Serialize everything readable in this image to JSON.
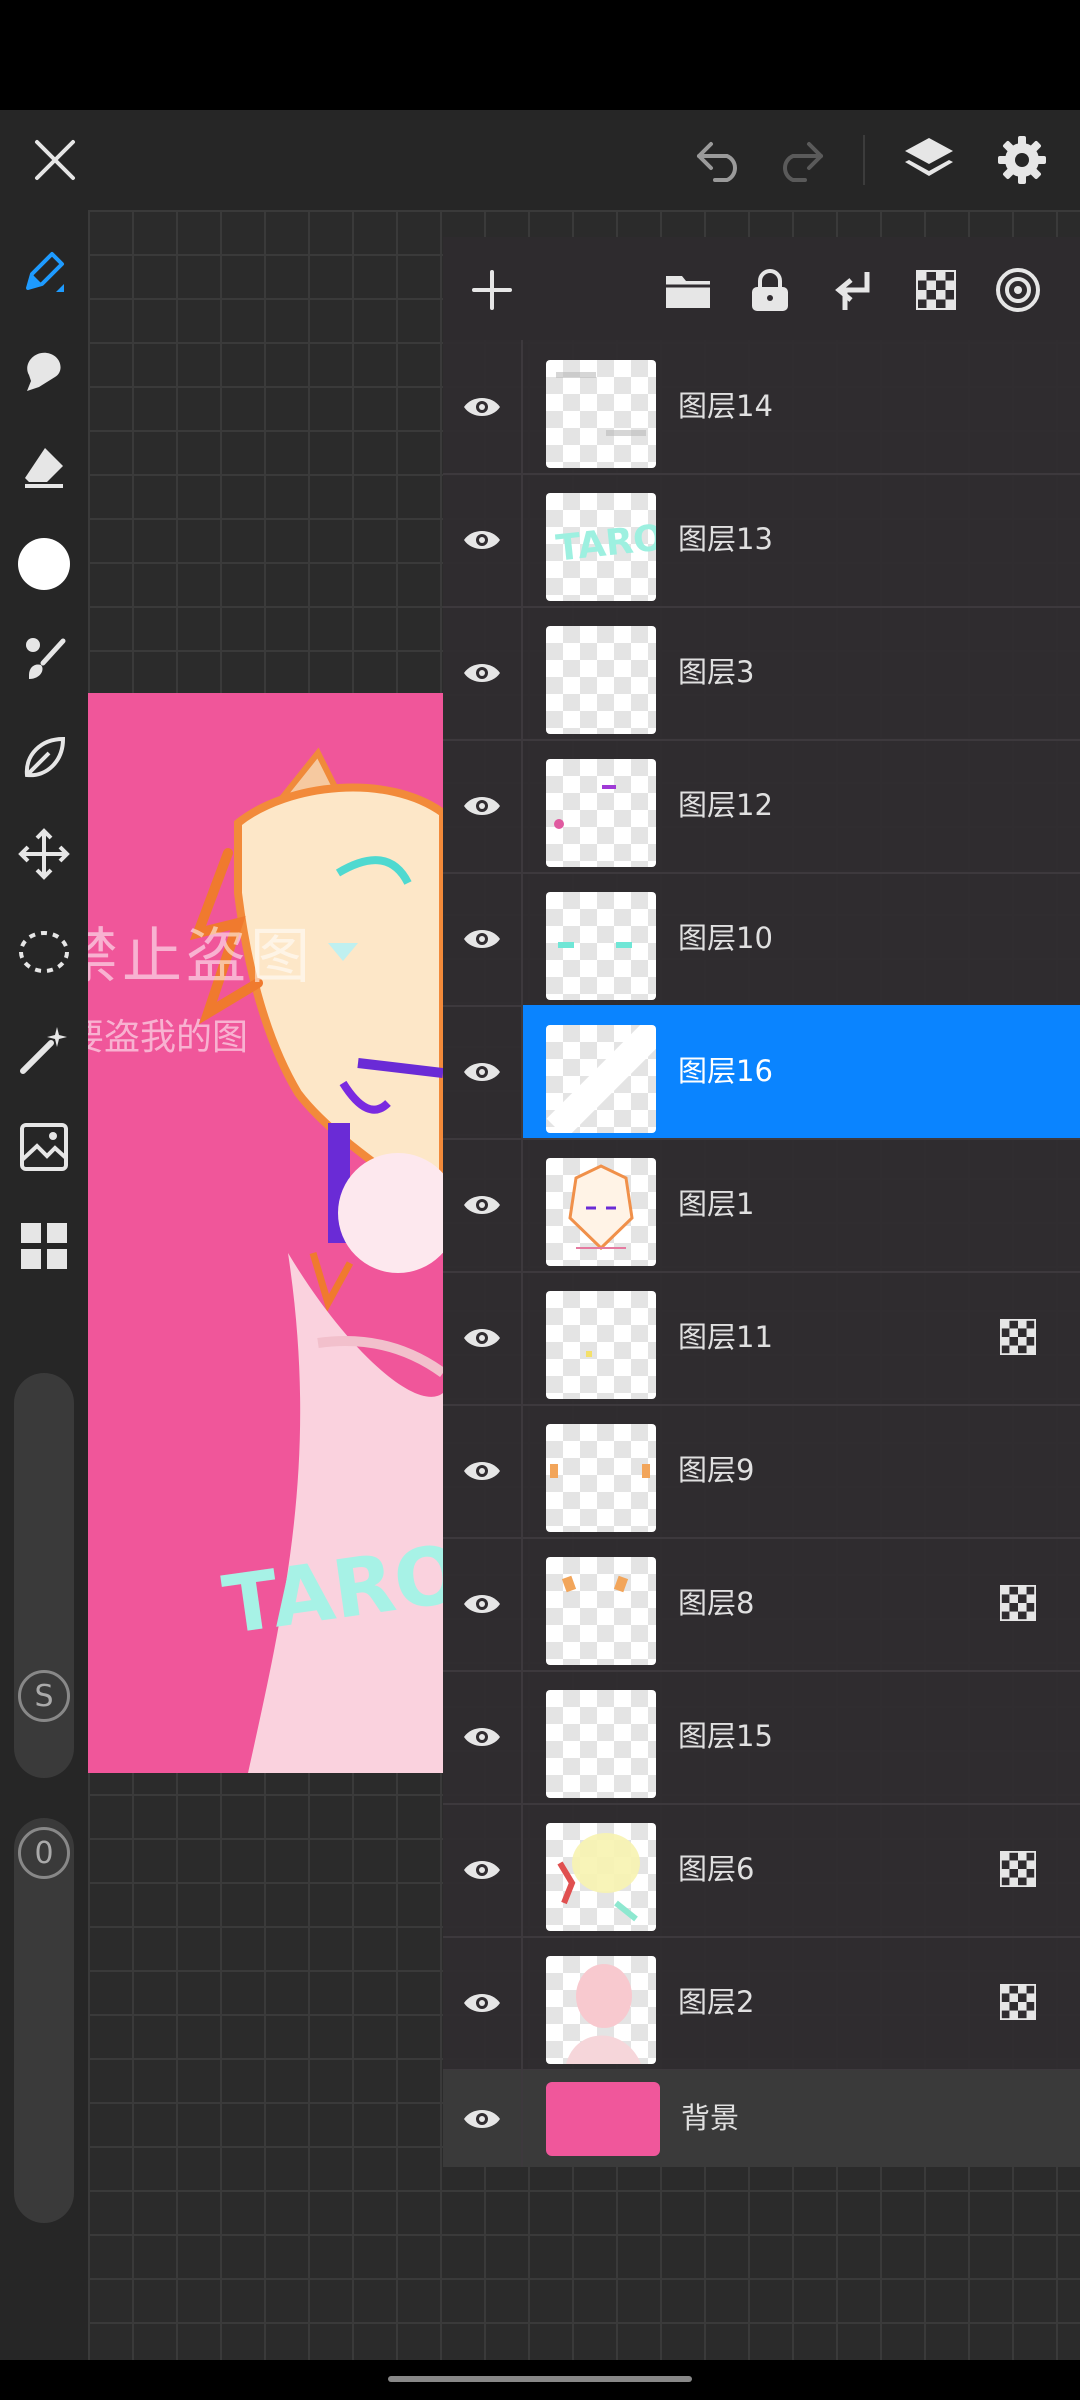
{
  "colors": {
    "accent": "#0a84ff",
    "canvas_bg": "#f0569a",
    "background_swatch": "#f0579b"
  },
  "topbar": {
    "icons": [
      "close-icon",
      "undo-icon",
      "redo-icon",
      "layers-icon",
      "settings-icon"
    ]
  },
  "toolbar": {
    "tools": [
      "pen-icon",
      "smudge-icon",
      "eraser-icon",
      "color-icon",
      "brush-icon",
      "lasso-shape-icon",
      "transform-icon",
      "selection-icon",
      "magic-wand-icon",
      "image-adjust-icon",
      "gallery-icon"
    ],
    "size_badge": "S",
    "opacity_badge": "0"
  },
  "layers_toolbar": {
    "icons": [
      "add-layer-icon",
      "folder-icon",
      "lock-icon",
      "merge-down-icon",
      "alpha-lock-icon",
      "blend-icon"
    ]
  },
  "artwork": {
    "watermark_line1": "禁止盗图",
    "watermark_line2": "要盗我的图",
    "signature": "TARO"
  },
  "layers": [
    {
      "name": "图层14",
      "alpha_lock": false,
      "selected": false
    },
    {
      "name": "图层13",
      "alpha_lock": false,
      "selected": false
    },
    {
      "name": "图层3",
      "alpha_lock": false,
      "selected": false
    },
    {
      "name": "图层12",
      "alpha_lock": false,
      "selected": false
    },
    {
      "name": "图层10",
      "alpha_lock": false,
      "selected": false
    },
    {
      "name": "图层16",
      "alpha_lock": false,
      "selected": true
    },
    {
      "name": "图层1",
      "alpha_lock": false,
      "selected": false
    },
    {
      "name": "图层11",
      "alpha_lock": true,
      "selected": false
    },
    {
      "name": "图层9",
      "alpha_lock": false,
      "selected": false
    },
    {
      "name": "图层8",
      "alpha_lock": true,
      "selected": false
    },
    {
      "name": "图层15",
      "alpha_lock": false,
      "selected": false
    },
    {
      "name": "图层6",
      "alpha_lock": true,
      "selected": false
    },
    {
      "name": "图层2",
      "alpha_lock": true,
      "selected": false
    }
  ],
  "background_layer": {
    "name": "背景"
  }
}
